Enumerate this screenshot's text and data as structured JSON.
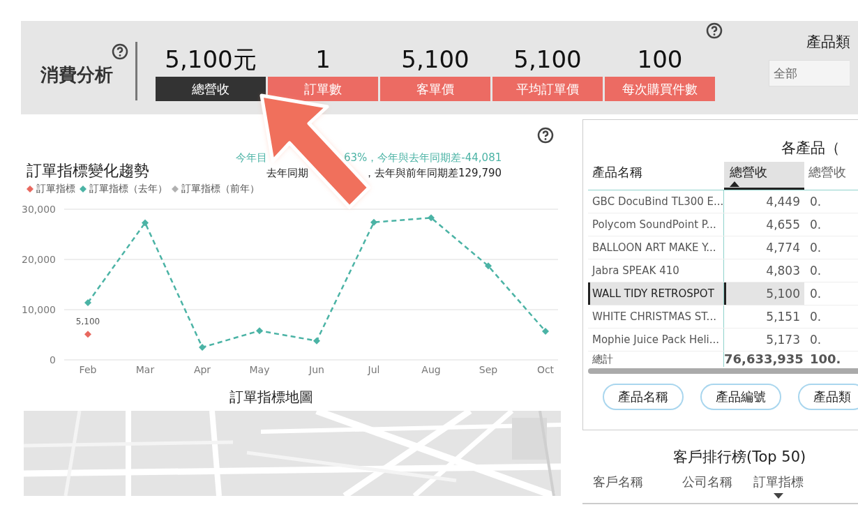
{
  "header": {
    "title": "消費分析",
    "kpis": [
      {
        "value": "5,100元",
        "label": "總營收",
        "selected": true
      },
      {
        "value": "1",
        "label": "訂單數",
        "selected": false
      },
      {
        "value": "5,100",
        "label": "客單價",
        "selected": false
      },
      {
        "value": "5,100",
        "label": "平均訂單價",
        "selected": false
      },
      {
        "value": "100",
        "label": "每次購買件數",
        "selected": false
      }
    ],
    "filter": {
      "label": "產品類",
      "value": "全部"
    }
  },
  "trend": {
    "title": "訂單指標變化趨勢",
    "note_1": [
      "今年目",
      "63%，今年與去年同期差-44,081"
    ],
    "note_2": [
      "去年同期",
      "，去年與前年同期差129,790"
    ],
    "chart_data": {
      "type": "line",
      "categories": [
        "Feb",
        "Mar",
        "Apr",
        "May",
        "Jun",
        "Jul",
        "Aug",
        "Sep",
        "Oct"
      ],
      "ylim": [
        0,
        30000
      ],
      "yticks": [
        {
          "value": 0,
          "label": "0"
        },
        {
          "value": 10000,
          "label": "10,000"
        },
        {
          "value": 20000,
          "label": "20,000"
        },
        {
          "value": 30000,
          "label": "30,000"
        }
      ],
      "series": [
        {
          "name": "訂單指標",
          "color": "#e8685f",
          "line_style": "solid",
          "marker": "diamond",
          "values": [
            5100,
            null,
            null,
            null,
            null,
            null,
            null,
            null,
            null
          ],
          "value_labels": [
            "5,100",
            null,
            null,
            null,
            null,
            null,
            null,
            null,
            null
          ]
        },
        {
          "name": "訂單指標（去年）",
          "color": "#4bb3a5",
          "line_style": "dashed",
          "marker": "diamond",
          "values": [
            11400,
            27300,
            2500,
            5800,
            3800,
            27400,
            28300,
            18700,
            5700
          ]
        },
        {
          "name": "訂單指標（前年）",
          "color": "#b0b0b0",
          "line_style": "dashed",
          "marker": "diamond",
          "values": [
            null,
            null,
            null,
            null,
            null,
            null,
            null,
            null,
            null
          ]
        }
      ]
    }
  },
  "map": {
    "title": "訂單指標地圖",
    "kind": "picture"
  },
  "products": {
    "title": "各產品（",
    "columns": [
      {
        "label": "產品名稱",
        "sort_ascending": false,
        "sort_descending": false
      },
      {
        "label": "總營收",
        "sort_ascending": true,
        "sort_descending": false
      },
      {
        "label": "總營收",
        "sort_ascending": false,
        "sort_descending": false
      }
    ],
    "rows": [
      {
        "cells": [
          "GBC DocuBind TL300 E...",
          "4,449",
          "0."
        ],
        "selected": false
      },
      {
        "cells": [
          "Polycom SoundPoint P...",
          "4,655",
          "0."
        ],
        "selected": false
      },
      {
        "cells": [
          "BALLOON ART MAKE Y...",
          "4,774",
          "0."
        ],
        "selected": false
      },
      {
        "cells": [
          "Jabra SPEAK 410",
          "4,803",
          "0."
        ],
        "selected": false
      },
      {
        "cells": [
          "WALL TIDY RETROSPOT",
          "5,100",
          "0."
        ],
        "selected": true
      },
      {
        "cells": [
          "WHITE CHRISTMAS ST...",
          "5,151",
          "0."
        ],
        "selected": false
      },
      {
        "cells": [
          "Mophie Juice Pack Heli...",
          "5,173",
          "0."
        ],
        "selected": false
      }
    ],
    "total": [
      "總計",
      "76,633,935",
      "100."
    ],
    "buttons": [
      "產品名稱",
      "產品編號",
      "產品類"
    ]
  },
  "customers": {
    "title": "客戶排行榜(Top 50)",
    "columns": [
      {
        "label": "客戶名稱",
        "sort_ascending": false,
        "sort_descending": false
      },
      {
        "label": "公司名稱",
        "sort_ascending": false,
        "sort_descending": false
      },
      {
        "label": "訂單指標",
        "sort_ascending": false,
        "sort_descending": true
      }
    ]
  }
}
